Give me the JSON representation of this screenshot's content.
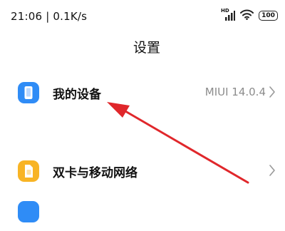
{
  "status_bar": {
    "time_speed": "21:06 | 0.1K/s",
    "signal_badge": "HD",
    "battery_level": "100",
    "icons": [
      "signal-icon",
      "wifi-icon",
      "battery-icon"
    ]
  },
  "header": {
    "title": "设置"
  },
  "settings": [
    {
      "label": "我的设备",
      "value": "MIUI 14.0.4",
      "icon": "phone-icon",
      "icon_color": "#2f8cf6"
    },
    {
      "label": "双卡与移动网络",
      "value": "",
      "icon": "sim-card-icon",
      "icon_color": "#f8b425"
    },
    {
      "icon": "partial-icon",
      "icon_color": "#2f8cf6"
    }
  ],
  "annotation": {
    "arrow_color": "#e0272b"
  }
}
